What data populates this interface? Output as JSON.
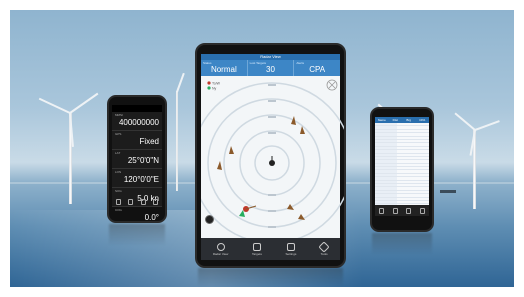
{
  "tablet": {
    "title": "Radar View",
    "stats": [
      {
        "label": "Status",
        "value": "Normal"
      },
      {
        "label": "Lost Targets",
        "value": "30"
      },
      {
        "label": "Alerts",
        "value": "CPA"
      }
    ],
    "legend": [
      {
        "label": "To/W",
        "color": "#c0392b"
      },
      {
        "label": "Ny",
        "color": "#27ae60"
      }
    ],
    "nav": [
      {
        "label": "Radar View",
        "icon": "radar-icon"
      },
      {
        "label": "Targets",
        "icon": "list-icon"
      },
      {
        "label": "Settings",
        "icon": "chart-icon"
      },
      {
        "label": "Tools",
        "icon": "wrench-icon"
      }
    ]
  },
  "left_phone": {
    "rows": [
      {
        "label": "MMSI",
        "value": "400000000"
      },
      {
        "label": "GPS",
        "value": "Fixed"
      },
      {
        "label": "LAT",
        "value": "25°0'0\"N"
      },
      {
        "label": "LON",
        "value": "120°0'0\"E"
      },
      {
        "label": "SOG",
        "value": "5.0 kn"
      },
      {
        "label": "COG",
        "value": "0.0°"
      }
    ]
  },
  "right_phone": {
    "headers": [
      "Name",
      "Dist",
      "Brg",
      "CPA"
    ],
    "row_count": 28
  },
  "colors": {
    "accent": "#3d86c6",
    "radar_ring": "#cfd9e1",
    "target": "#8b5a2b"
  }
}
